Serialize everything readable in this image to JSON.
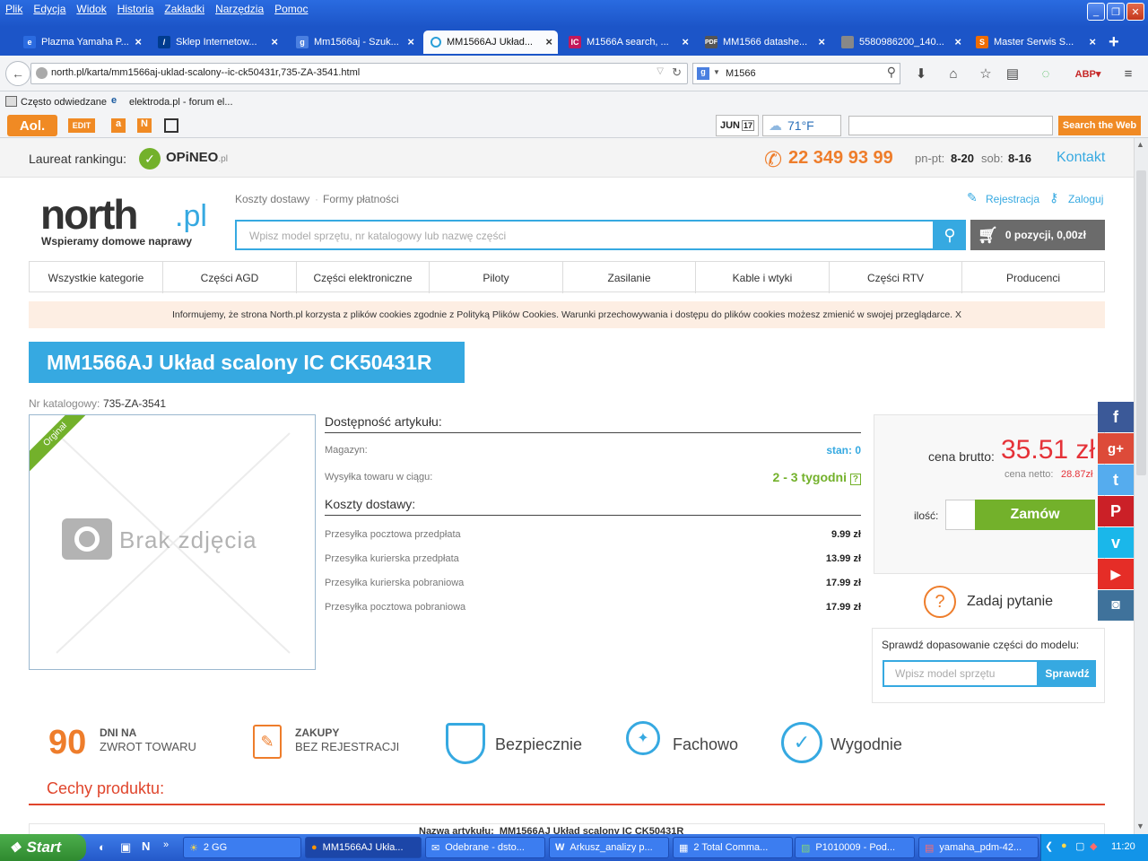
{
  "browser": {
    "menu": [
      "Plik",
      "Edycja",
      "Widok",
      "Historia",
      "Zakładki",
      "Narzędzia",
      "Pomoc"
    ],
    "tabs": [
      {
        "label": "Plazma Yamaha P...",
        "icon_color": "#2b6be0",
        "active": false
      },
      {
        "label": "Sklep Internetow...",
        "icon_color": "#003c8f",
        "active": false
      },
      {
        "label": "Mm1566aj - Szuk...",
        "icon_color": "#4a7fe0",
        "active": false
      },
      {
        "label": "MM1566AJ Układ...",
        "icon_color": "#2a9fd8",
        "active": true
      },
      {
        "label": "M1566A search, ...",
        "icon_color": "#c2185b",
        "active": false
      },
      {
        "label": "MM1566 datashe...",
        "icon_color": "#555",
        "active": false
      },
      {
        "label": "5580986200_140...",
        "icon_color": "#777",
        "active": false
      },
      {
        "label": "Master Serwis S...",
        "icon_color": "#ef6c00",
        "active": false
      }
    ],
    "url": "north.pl/karta/mm1566aj-uklad-scalony--ic-ck50431r,735-ZA-3541.html",
    "search_value": "M1566",
    "bookmarks": [
      "Często odwiedzane",
      "elektroda.pl - forum el..."
    ],
    "aol": {
      "logo": "Aol.",
      "edit": "EDIT",
      "weather_month": "JUN",
      "weather_day": "17",
      "temperature": "71°F",
      "search_button": "Search the Web"
    }
  },
  "header": {
    "laureat_label": "Laureat rankingu:",
    "opineo": "OPiNEO",
    "opineo_suffix": ".pl",
    "phone": "22 349 93 99",
    "hours_weekday_label": "pn-pt:",
    "hours_weekday": "8-20",
    "hours_saturday_label": "sob:",
    "hours_saturday": "8-16",
    "contact": "Kontakt",
    "logo_main": "north",
    "logo_suffix": ".pl",
    "tagline": "Wspieramy domowe naprawy",
    "links": [
      "Koszty dostawy",
      "Formy płatności"
    ],
    "register": "Rejestracja",
    "login": "Zaloguj",
    "search_placeholder": "Wpisz model sprzętu, nr katalogowy lub nazwę części",
    "cart": "0 pozycji, 0,00zł"
  },
  "categories": [
    "Wszystkie kategorie",
    "Części AGD",
    "Części elektroniczne",
    "Piloty",
    "Zasilanie",
    "Kable i wtyki",
    "Części RTV",
    "Producenci"
  ],
  "cookie_notice": "Informujemy, że strona North.pl korzysta z plików cookies zgodnie z Polityką Plików Cookies. Warunki przechowywania i dostępu do plików cookies możesz zmienić w swojej przeglądarce. X",
  "product": {
    "title": "MM1566AJ Układ scalony IC CK50431R",
    "catalog_label": "Nr katalogowy:",
    "catalog_number": "735-ZA-3541",
    "ribbon": "Orginał",
    "no_photo": "Brak zdjęcia",
    "availability_heading": "Dostępność artykułu:",
    "stock_label": "Magazyn:",
    "stock_value": "stan: 0",
    "shipping_label": "Wysyłka towaru w ciągu:",
    "shipping_value": "2 - 3 tygodni",
    "delivery_heading": "Koszty dostawy:",
    "delivery": [
      {
        "label": "Przesyłka pocztowa przedpłata",
        "price": "9.99 zł"
      },
      {
        "label": "Przesyłka kurierska przedpłata",
        "price": "13.99 zł"
      },
      {
        "label": "Przesyłka kurierska pobraniowa",
        "price": "17.99 zł"
      },
      {
        "label": "Przesyłka pocztowa pobraniowa",
        "price": "17.99 zł"
      }
    ],
    "gross_label": "cena brutto:",
    "gross_price": "35.51 zł",
    "net_label": "cena netto:",
    "net_price": "28.87zł",
    "qty_label": "ilość:",
    "order_button": "Zamów",
    "ask_question": "Zadaj pytanie",
    "check_label": "Sprawdź dopasowanie części do modelu:",
    "check_placeholder": "Wpisz model sprzętu",
    "check_button": "Sprawdź"
  },
  "features": {
    "return_days": "90",
    "return_line1": "DNI NA",
    "return_line2": "ZWROT TOWARU",
    "purchase_line1": "ZAKUPY",
    "purchase_line2": "BEZ REJESTRACJI",
    "safe": "Bezpiecznie",
    "pro": "Fachowo",
    "convenient": "Wygodnie"
  },
  "section_title": "Cechy produktu:",
  "cutoff_row": "Nazwa artykułu:  MM1566AJ Układ scalony IC CK50431R",
  "colors": {
    "brand_blue": "#36a9e1",
    "brand_orange": "#ee7d2b",
    "green": "#73b12b",
    "price_red": "#e53238"
  },
  "taskbar": {
    "start": "Start",
    "tasks": [
      {
        "label": "2 GG"
      },
      {
        "label": "MM1566AJ Ukła..."
      },
      {
        "label": "Odebrane - dsto..."
      },
      {
        "label": "Arkusz_analizy p..."
      },
      {
        "label": "2 Total Comma..."
      },
      {
        "label": "P1010009 - Pod..."
      },
      {
        "label": "yamaha_pdm-42..."
      }
    ],
    "clock": "11:20"
  }
}
